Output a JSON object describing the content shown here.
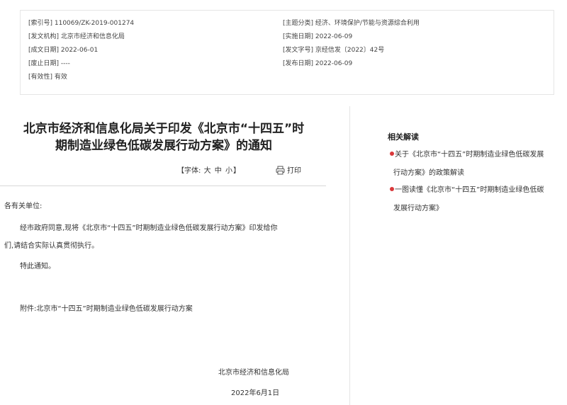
{
  "meta": {
    "index_no": "[索引号] 110069/ZK-2019-001274",
    "issuer": "[发文机构] 北京市经济和信息化局",
    "created_date": "[成文日期] 2022-06-01",
    "repeal_date": "[废止日期] ----",
    "validity": "[有效性] 有效",
    "category": "[主题分类] 经济、环境保护/节能与资源综合利用",
    "effective_date": "[实施日期] 2022-06-09",
    "doc_no": "[发文字号] 京经信发〔2022〕42号",
    "publish_date": "[发布日期] 2022-06-09"
  },
  "article": {
    "title_line1": "北京市经济和信息化局关于印发《北京市“十四五”时",
    "title_line2": "期制造业绿色低碳发展行动方案》的通知",
    "font_label": "【字体:",
    "font_large": "大",
    "font_medium": "中",
    "font_small": "小",
    "font_close": "】",
    "print_label": "打印",
    "salutation": "各有关单位:",
    "para1_line1": "经市政府同意,现将《北京市“十四五”时期制造业绿色低碳发展行动方案》印发给你",
    "para1_line2": "们,请结合实际认真贯彻执行。",
    "para2": "特此通知。",
    "attachment": "附件:北京市“十四五”时期制造业绿色低碳发展行动方案",
    "signer": "北京市经济和信息化局",
    "sign_date": "2022年6月1日"
  },
  "sidebar": {
    "title": "相关解读",
    "links": [
      {
        "line1": "关于《北京市“十四五”时期制造业绿色低碳发展",
        "line2": "行动方案》的政策解读"
      },
      {
        "line1": "一图读懂《北京市“十四五”时期制造业绿色低碳",
        "line2": "发展行动方案》"
      }
    ]
  }
}
